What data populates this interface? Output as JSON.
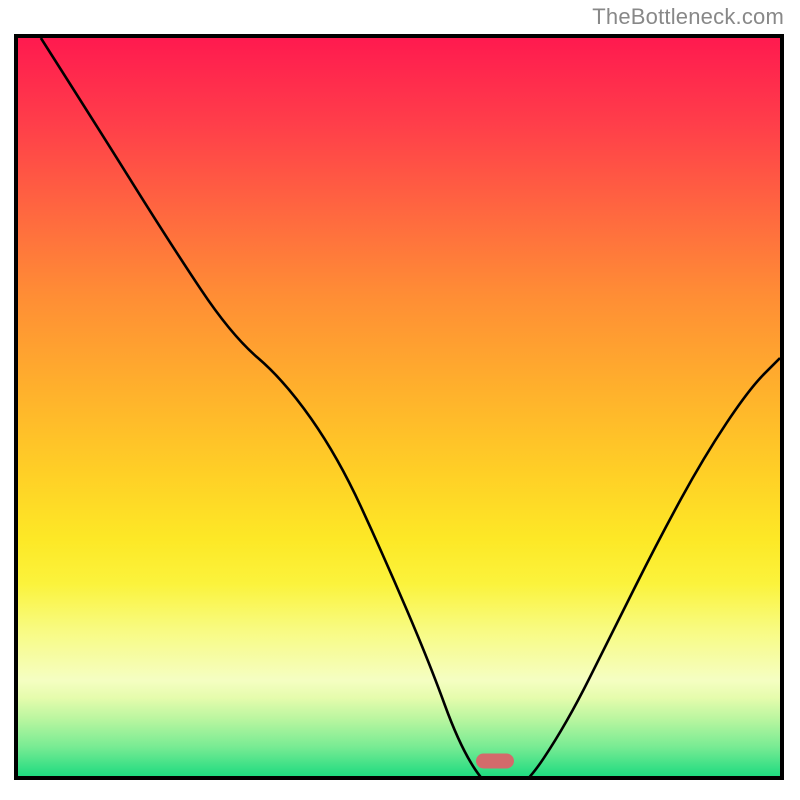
{
  "watermark": "TheBottleneck.com",
  "chart_data": {
    "type": "line",
    "title": "",
    "xlabel": "",
    "ylabel": "",
    "xlim": [
      0,
      100
    ],
    "ylim": [
      0,
      100
    ],
    "grid": false,
    "legend": false,
    "background_gradient_stops": [
      {
        "pos": 0.0,
        "color": "#ff1a4f"
      },
      {
        "pos": 0.13,
        "color": "#ff3d4a"
      },
      {
        "pos": 0.28,
        "color": "#ff6a3f"
      },
      {
        "pos": 0.4,
        "color": "#ff8d35"
      },
      {
        "pos": 0.55,
        "color": "#ffb12c"
      },
      {
        "pos": 0.68,
        "color": "#ffd026"
      },
      {
        "pos": 0.78,
        "color": "#fde826"
      },
      {
        "pos": 0.85,
        "color": "#fbf33c"
      },
      {
        "pos": 0.88,
        "color": "#f5fec2"
      },
      {
        "pos": 0.92,
        "color": "#bbf6a0"
      },
      {
        "pos": 0.96,
        "color": "#77eb93"
      },
      {
        "pos": 1.0,
        "color": "#1fdb80"
      }
    ],
    "curve": {
      "description": "V-shaped bottleneck curve. Values are percent-of-height (0 = bottom, 100 = top) vs percent-of-width.",
      "x": [
        3,
        10,
        20,
        28,
        35,
        42,
        48,
        54,
        58,
        62,
        66,
        72,
        78,
        84,
        90,
        96,
        100
      ],
      "y": [
        100,
        89,
        73,
        61,
        55,
        45,
        32,
        18,
        7,
        1,
        1,
        10,
        22,
        34,
        45,
        54,
        58
      ]
    },
    "marker": {
      "x": 62.6,
      "y": 2.0,
      "color": "#d36a6b",
      "shape": "rounded-bar"
    }
  },
  "colors": {
    "frame": "#000000",
    "curve": "#000000",
    "marker": "#d36a6b",
    "watermark": "#888888"
  }
}
